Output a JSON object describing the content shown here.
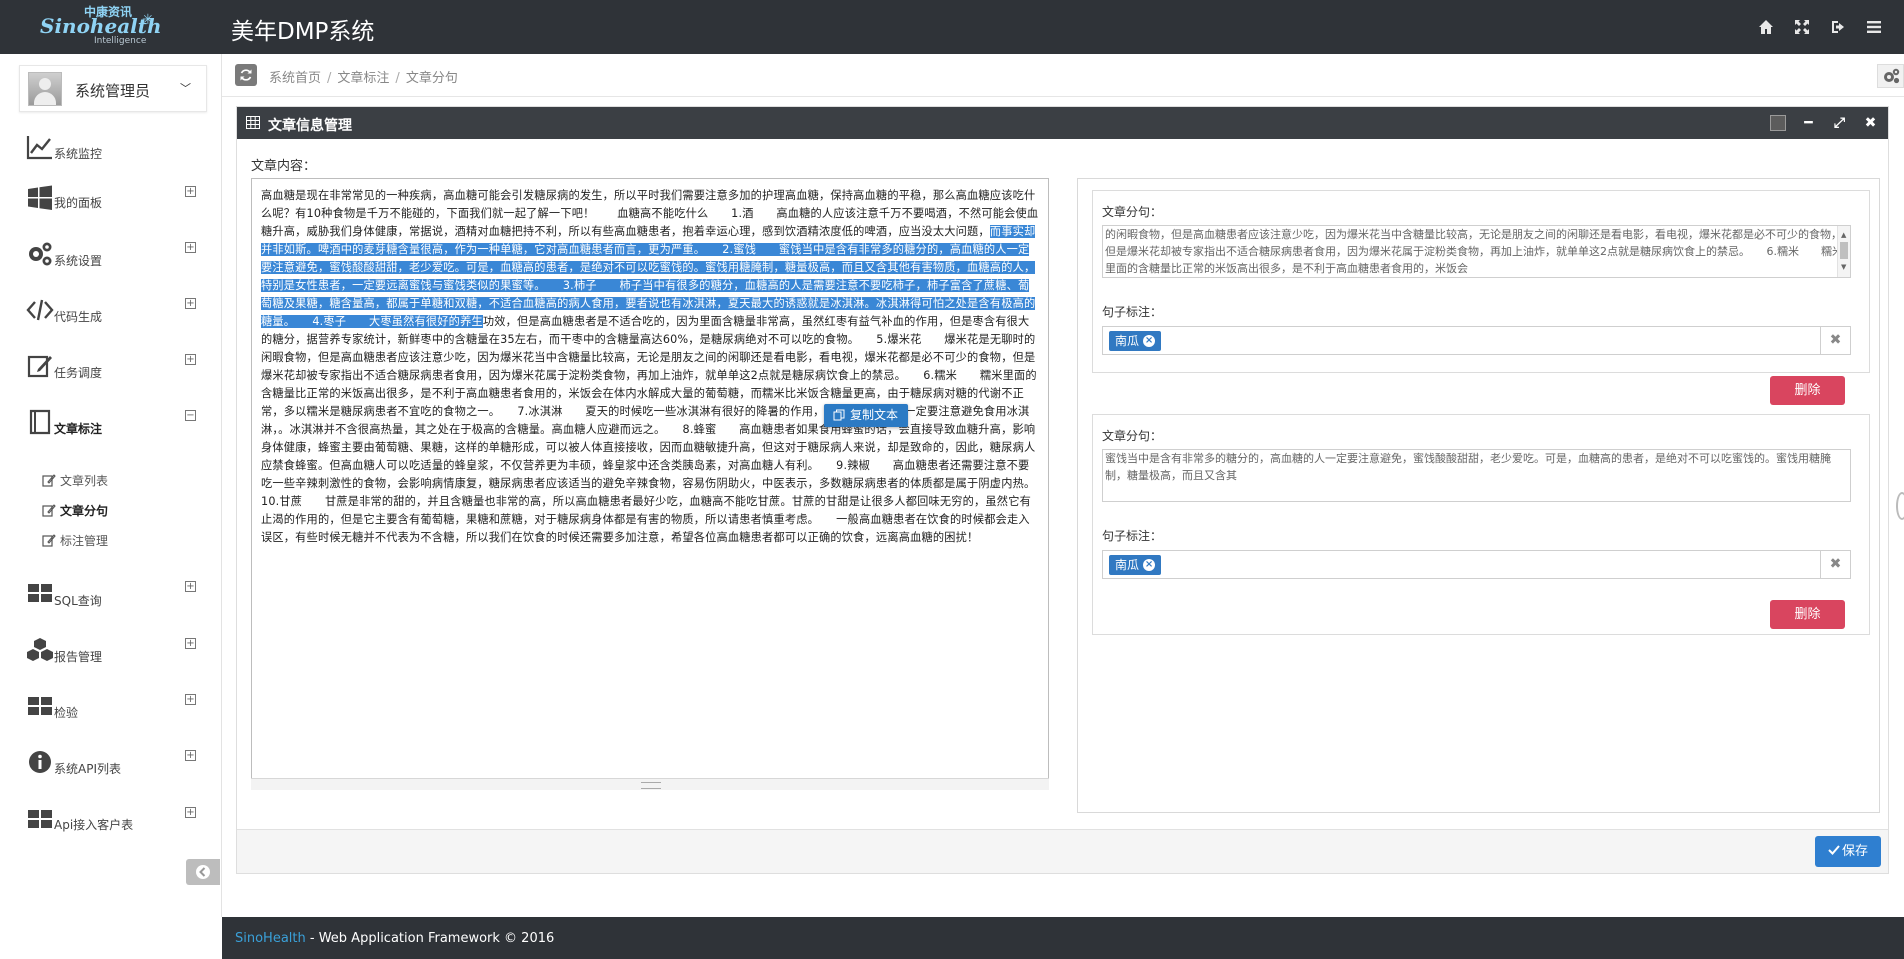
{
  "header": {
    "logo_cn": "中康资讯",
    "logo_en": "Sinohealth",
    "logo_sub": "Intelligence",
    "app_title": "美年DMP系统",
    "icons": [
      "home-icon",
      "fullscreen-icon",
      "logout-icon",
      "menu-icon"
    ]
  },
  "user": {
    "name": "系统管理员"
  },
  "sidebar": {
    "items": [
      {
        "label": "系统监控",
        "icon": "chart-line-icon"
      },
      {
        "label": "我的面板",
        "icon": "windows-icon"
      },
      {
        "label": "系统设置",
        "icon": "gears-icon"
      },
      {
        "label": "代码生成",
        "icon": "code-icon"
      },
      {
        "label": "任务调度",
        "icon": "edit-icon"
      },
      {
        "label": "文章标注",
        "icon": "book-icon"
      },
      {
        "label": "SQL查询",
        "icon": "grid-icon"
      },
      {
        "label": "报告管理",
        "icon": "cubes-icon"
      },
      {
        "label": "检验",
        "icon": "grid-icon"
      },
      {
        "label": "系统API列表",
        "icon": "info-icon"
      },
      {
        "label": "Api接入客户表",
        "icon": "grid-icon"
      }
    ],
    "sub_items": [
      {
        "label": "文章列表"
      },
      {
        "label": "文章分句"
      },
      {
        "label": "标注管理"
      }
    ]
  },
  "breadcrumb": {
    "items": [
      "系统首页",
      "文章标注",
      "文章分句"
    ]
  },
  "panel": {
    "title": "文章信息管理",
    "content_label": "文章内容：",
    "content_pre": "高血糖是现在非常常见的一种疾病，高血糖可能会引发糖尿病的发生，所以平时我们需要注意多加的护理高血糖，保持高血糖的平稳，那么高血糖应该吃什么呢？有10种食物是千万不能碰的，下面我们就一起了解一下吧！　　血糖高不能吃什么　　1.酒　　高血糖的人应该注意千万不要喝酒，不然可能会使血糖升高，威胁我们身体健康，常据说，酒精对血糖把持不利，所以有些高血糖患者，抱着幸运心理，感到饮酒精浓度低的啤酒，应当没太大问题，",
    "content_highlight": "而事实却并非如斯。啤酒中的麦芽糖含量很高，作为一种单糖，它对高血糖患者而言，更为严重。　　2.蜜饯　　蜜饯当中是含有非常多的糖分的，高血糖的人一定要注意避免，蜜饯酸酸甜甜，老少爱吃。可是，血糖高的患者，是绝对不可以吃蜜饯的。蜜饯用糖腌制，糖量极高，而且又含其他有害物质，血糖高的人，特别是女性患者，一定要远离蜜饯与蜜饯类似的果蜜等。　　3.柿子　　柿子当中有很多的糖分，血糖高的人是需要注意不要吃柿子，柿子富含了蔗糖、葡萄糖及果糖，糖含量高，都属于单糖和双糖，不适合血糖高的病人食用，要者说也有冰淇淋，夏天最大的诱惑就是冰淇淋。冰淇淋得可怕之处是含有极高的糖量。　　4.枣子　　大枣虽然有很好的养生",
    "content_post": "功效，但是高血糖患者是不适合吃的，因为里面含糖量非常高，虽然红枣有益气补血的作用，但是枣含有很大的糖分，据营养专家统计，新鲜枣中的含糖量在35左右，而干枣中的含糖量高达60%，是糖尿病绝对不可以吃的食物。　　5.爆米花　　爆米花是无聊时的闲暇食物，但是高血糖患者应该注意少吃，因为爆米花当中含糖量比较高，无论是朋友之间的闲聊还是看电影，看电视，爆米花都是必不可少的食物，但是爆米花却被专家指出不适合糖尿病患者食用，因为爆米花属于淀粉类食物，再加上油炸，就单单这2点就是糖尿病饮食上的禁忌。　　6.糯米　　糯米里面的含糖量比正常的米饭高出很多，是不利于高血糖患者食用的，米饭会在体内水解成大量的葡萄糖，而糯米比米饭含糖量更高，由于糖尿病对糖的代谢不正常，多以糯米是糖尿病患者不宜吃的食物之一。　　7.冰淇淋　　夏天的时候吃一些冰淇淋有很好的降暑的作用，但是高血糖患者一定要注意避免食用冰淇淋，。冰淇淋并不含很高热量，其之处在于极高的含糖量。高血糖人应避而远之。　　8.蜂蜜　　高血糖患者如果食用蜂蜜的话，会直接导致血糖升高，影响身体健康，蜂蜜主要由葡萄糖、果糖，这样的单糖形成，可以被人体直接接收，因而血糖敏捷升高，但这对于糖尿病人来说，却是致命的，因此，糖尿病人应禁食蜂蜜。但高血糖人可以吃适量的蜂皇浆，不仅营养更为丰硕，蜂皇浆中还含类胰岛素，对高血糖人有利。　　9.辣椒　　高血糖患者还需要注意不要吃一些辛辣刺激性的食物，会影响病情康复，糖尿病患者应该适当的避免辛辣食物，容易伤阴助火，中医表示，多数糖尿病患者的体质都是属于阴虚内热。　　10.甘蔗　　甘蔗是非常的甜的，并且含糖量也非常的高，所以高血糖患者最好少吃，血糖高不能吃甘蔗。甘蔗的甘甜是让很多人都回味无穷的，虽然它有止渴的作用的，但是它主要含有葡萄糖，果糖和蔗糖，对于糖尿病身体都是有害的物质，所以请患者慎重考虑。　　一般高血糖患者在饮食的时候都会走入误区，有些时候无糖并不代表为不含糖，所以我们在饮食的时候还需要多加注意，希望各位高血糖患者都可以正确的饮食，远离高血糖的困扰！",
    "copy_tip": "复制文本",
    "segments": [
      {
        "label": "文章分句：",
        "text": "的闲暇食物，但是高血糖患者应该注意少吃，因为爆米花当中含糖量比较高，无论是朋友之间的闲聊还是看电影，看电视，爆米花都是必不可少的食物，但是爆米花却被专家指出不适合糖尿病患者食用，因为爆米花属于淀粉类食物，再加上油炸，就单单这2点就是糖尿病饮食上的禁忌。　　6.糯米　　糯米里面的含糖量比正常的米饭高出很多，是不利于高血糖患者食用的，米饭会",
        "tag_label": "句子标注：",
        "tag": "南瓜",
        "delete": "删除"
      },
      {
        "label": "文章分句：",
        "text": "蜜饯当中是含有非常多的糖分的，高血糖的人一定要注意避免，蜜饯酸酸甜甜，老少爱吃。可是，血糖高的患者，是绝对不可以吃蜜饯的。蜜饯用糖腌制，糖量极高，而且又含其",
        "tag_label": "句子标注：",
        "tag": "南瓜",
        "delete": "删除"
      }
    ],
    "save": "保存"
  },
  "footer": {
    "brand": "SinoHealth",
    "text": " - Web Application Framework © 2016"
  },
  "colors": {
    "topbar": "#2f3338",
    "primary": "#2f7fd0",
    "danger": "#d9455f",
    "highlight": "#3a87d6",
    "tag": "#3179c2"
  }
}
